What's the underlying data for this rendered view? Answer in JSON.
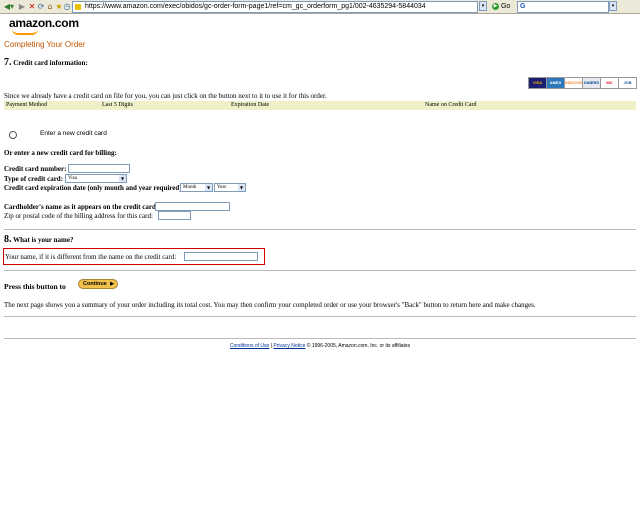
{
  "browser": {
    "url": "https://www.amazon.com/exec/obidos/gc-order-form-page1/ref=cm_gc_orderform_pg1/002-4635294-5844034",
    "go_label": "Go",
    "search_brand": "G"
  },
  "logo": {
    "text": "amazon.com"
  },
  "page_title": "Completing Your Order",
  "section7": {
    "number": "7.",
    "title": "Credit card information:",
    "notice": "Since we already have a credit card on file for you, you can just click on the button next to it to use it for this order.",
    "card_logos": [
      "VISA",
      "AMEX",
      "DISCOVER",
      "DINERS",
      "MC",
      "JCB"
    ],
    "table_headers": [
      "Payment Method",
      "Last 5 Digits",
      "Expiration Date",
      "Name on Credit Card"
    ],
    "new_card_option": "Enter a new credit card",
    "or_enter": "Or enter a new credit card for billing:",
    "card_number_label": "Credit card number:",
    "card_type_label": "Type of credit card:",
    "card_type_value": "Visa",
    "expiration_label": "Credit card expiration date (only month and year required):",
    "month_value": "Month",
    "year_value": "Year",
    "cardholder_label": "Cardholder's name as it appears on the credit card:",
    "zip_label": "Zip or postal code of the billing address for this card:"
  },
  "section8": {
    "number": "8.",
    "title": "What is your name?",
    "name_label": "Your name, if it is different from the name on the credit card:"
  },
  "press": {
    "label": "Press this button to",
    "button_label": "Continue"
  },
  "summary_note": "The next page shows you a summary of your order including its total cost. You may then confirm your completed order or use your browser's \"Back\" button to return here and make changes.",
  "footer": {
    "conditions": "Conditions of Use",
    "separator": "|",
    "privacy": "Privacy Notice",
    "copyright": "© 1996-2005, Amazon.com, Inc. or its affiliates"
  }
}
